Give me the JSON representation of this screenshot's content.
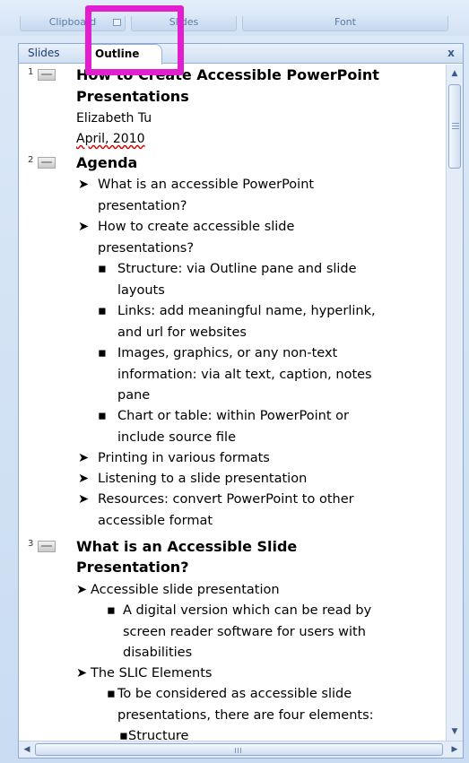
{
  "ribbon": {
    "groups": [
      "Clipboard",
      "Slides",
      "Font"
    ]
  },
  "pane": {
    "tabs": [
      "Slides",
      "Outline"
    ],
    "active_tab": "Outline",
    "close_label": "x"
  },
  "outline": {
    "slides": [
      {
        "number": "1",
        "title_lines": [
          "How to Create Accessible PowerPoint",
          "Presentations"
        ],
        "subtitle_lines": [
          "Elizabeth Tu",
          "April, 2010"
        ]
      },
      {
        "number": "2",
        "title_lines": [
          "Agenda"
        ],
        "bullets": [
          {
            "lines": [
              "What is an accessible PowerPoint",
              "presentation?"
            ]
          },
          {
            "lines": [
              "How to create accessible slide",
              "presentations?"
            ]
          },
          {
            "lines": [
              "Structure: via Outline pane and slide",
              "layouts"
            ]
          },
          {
            "lines": [
              "Links: add meaningful  name, hyperlink,",
              "and url for websites"
            ]
          },
          {
            "lines": [
              "Images, graphics, or any non-text",
              "information: via alt text, caption, notes",
              "pane"
            ]
          },
          {
            "lines": [
              "Chart or table: within PowerPoint or",
              "include source file"
            ]
          },
          {
            "lines": [
              "Printing in various formats"
            ]
          },
          {
            "lines": [
              "Listening to a slide presentation"
            ]
          },
          {
            "lines": [
              "Resources: convert PowerPoint to other",
              "accessible format"
            ]
          }
        ]
      },
      {
        "number": "3",
        "title_lines": [
          "What is an Accessible Slide",
          "Presentation?"
        ],
        "bullets": [
          {
            "lines": [
              "Accessible slide presentation"
            ]
          },
          {
            "lines": [
              "A digital version which can be read by",
              "screen reader software for users with",
              "disabilities"
            ]
          },
          {
            "lines": [
              "The SLIC Elements"
            ]
          },
          {
            "lines": [
              "To be considered as accessible slide",
              "presentations, there are four elements:"
            ]
          },
          {
            "lines": [
              "Structure"
            ]
          }
        ]
      }
    ]
  },
  "glyphs": {
    "arrow_bullet": "➤",
    "square_bullet": "▪",
    "scroll_up": "▲",
    "scroll_down": "▼",
    "scroll_left": "◀",
    "scroll_right": "▶"
  },
  "colors": {
    "highlight": "#e11fcf",
    "pane_border": "#8ea9cf",
    "spell_underline": "#d00000"
  }
}
